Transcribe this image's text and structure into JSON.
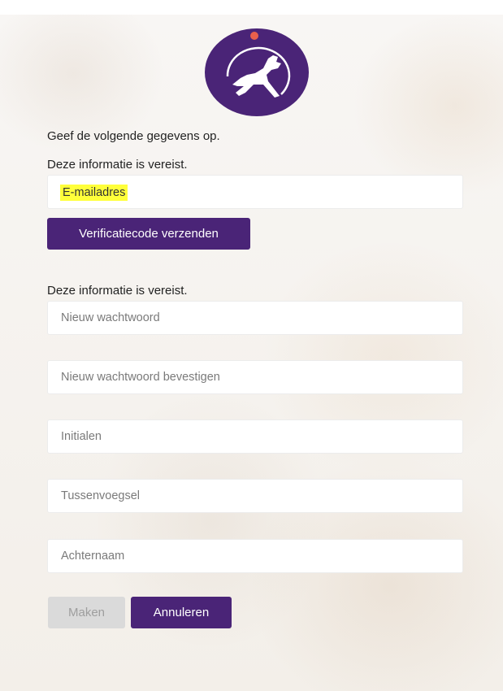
{
  "header": {
    "instruction": "Geef de volgende gegevens op.",
    "required_1": "Deze informatie is vereist.",
    "required_2": "Deze informatie is vereist."
  },
  "form": {
    "email_placeholder": "E-mailadres",
    "send_code_label": "Verificatiecode verzenden",
    "new_password_placeholder": "Nieuw wachtwoord",
    "confirm_password_placeholder": "Nieuw wachtwoord bevestigen",
    "initials_placeholder": "Initialen",
    "infix_placeholder": "Tussenvoegsel",
    "lastname_placeholder": "Achternaam"
  },
  "actions": {
    "create_label": "Maken",
    "cancel_label": "Annuleren"
  },
  "colors": {
    "brand": "#4a2477",
    "highlight": "#ffff3a",
    "logo_dot": "#e8604c"
  },
  "icons": {
    "logo": "running-dog-logo"
  }
}
